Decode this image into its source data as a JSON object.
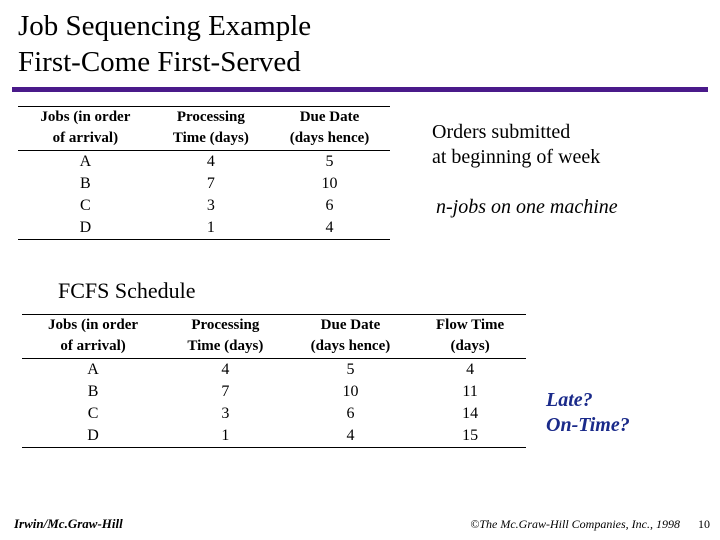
{
  "title": {
    "line1": "Job Sequencing Example",
    "line2": "First-Come First-Served"
  },
  "captions": {
    "orders_line1": "Orders submitted",
    "orders_line2": "at beginning of week",
    "njobs": "n-jobs on one machine",
    "subhead": "FCFS Schedule",
    "late_line1": "Late?",
    "late_line2": "On-Time?"
  },
  "table1": {
    "headers": {
      "c0a": "Jobs (in order",
      "c0b": "of arrival)",
      "c1a": "Processing",
      "c1b": "Time (days)",
      "c2a": "Due Date",
      "c2b": "(days hence)"
    },
    "rows": [
      {
        "job": "A",
        "proc": "4",
        "due": "5"
      },
      {
        "job": "B",
        "proc": "7",
        "due": "10"
      },
      {
        "job": "C",
        "proc": "3",
        "due": "6"
      },
      {
        "job": "D",
        "proc": "1",
        "due": "4"
      }
    ]
  },
  "table2": {
    "headers": {
      "c0a": "Jobs (in order",
      "c0b": "of arrival)",
      "c1a": "Processing",
      "c1b": "Time (days)",
      "c2a": "Due Date",
      "c2b": "(days hence)",
      "c3a": "Flow Time",
      "c3b": "(days)"
    },
    "rows": [
      {
        "job": "A",
        "proc": "4",
        "due": "5",
        "flow": "4"
      },
      {
        "job": "B",
        "proc": "7",
        "due": "10",
        "flow": "11"
      },
      {
        "job": "C",
        "proc": "3",
        "due": "6",
        "flow": "14"
      },
      {
        "job": "D",
        "proc": "1",
        "due": "4",
        "flow": "15"
      }
    ]
  },
  "footer": {
    "left": "Irwin/Mc.Graw-Hill",
    "right": "©The Mc.Graw-Hill Companies, Inc., 1998",
    "page": "10"
  }
}
